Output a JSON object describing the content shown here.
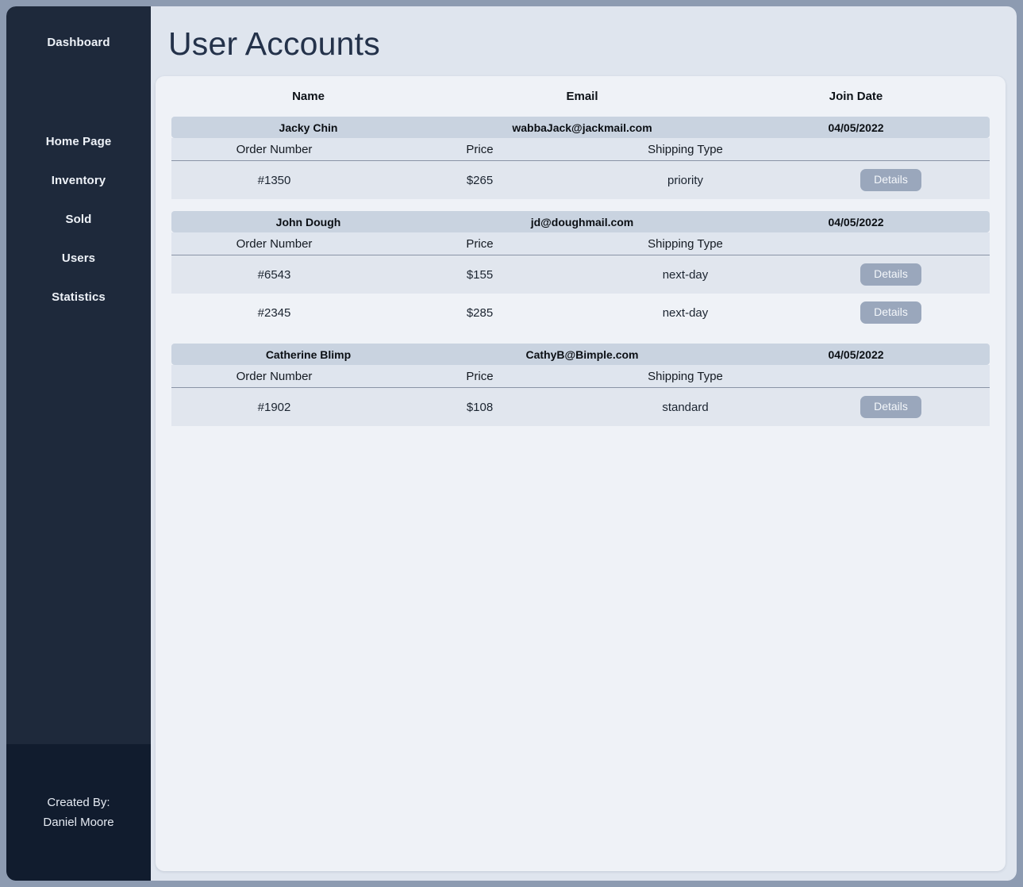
{
  "sidebar": {
    "brand": "Dashboard",
    "items": [
      {
        "label": "Home Page"
      },
      {
        "label": "Inventory"
      },
      {
        "label": "Sold"
      },
      {
        "label": "Users"
      },
      {
        "label": "Statistics"
      }
    ],
    "footer": {
      "line1": "Created By:",
      "line2": "Daniel Moore"
    }
  },
  "page": {
    "title": "User Accounts"
  },
  "table": {
    "user_columns": [
      "Name",
      "Email",
      "Join Date"
    ],
    "order_columns": [
      "Order Number",
      "Price",
      "Shipping Type"
    ],
    "details_label": "Details"
  },
  "users": [
    {
      "name": "Jacky Chin",
      "email": "wabbaJack@jackmail.com",
      "join_date": "04/05/2022",
      "orders": [
        {
          "order_number": "#1350",
          "price": "$265",
          "shipping_type": "priority"
        }
      ]
    },
    {
      "name": "John Dough",
      "email": "jd@doughmail.com",
      "join_date": "04/05/2022",
      "orders": [
        {
          "order_number": "#6543",
          "price": "$155",
          "shipping_type": "next-day"
        },
        {
          "order_number": "#2345",
          "price": "$285",
          "shipping_type": "next-day"
        }
      ]
    },
    {
      "name": "Catherine Blimp",
      "email": "CathyB@Bimple.com",
      "join_date": "04/05/2022",
      "orders": [
        {
          "order_number": "#1902",
          "price": "$108",
          "shipping_type": "standard"
        }
      ]
    }
  ],
  "colors": {
    "page_background": "#8d9bb1",
    "sidebar": "#1e293b",
    "sidebar_footer": "#111c2e",
    "panel": "#dfe5ee",
    "card": "#eff2f7",
    "user_row": "#c9d3e0",
    "order_row_shade": "#e1e6ee",
    "details_button": "#9aa7bc",
    "title_text": "#24324a"
  }
}
